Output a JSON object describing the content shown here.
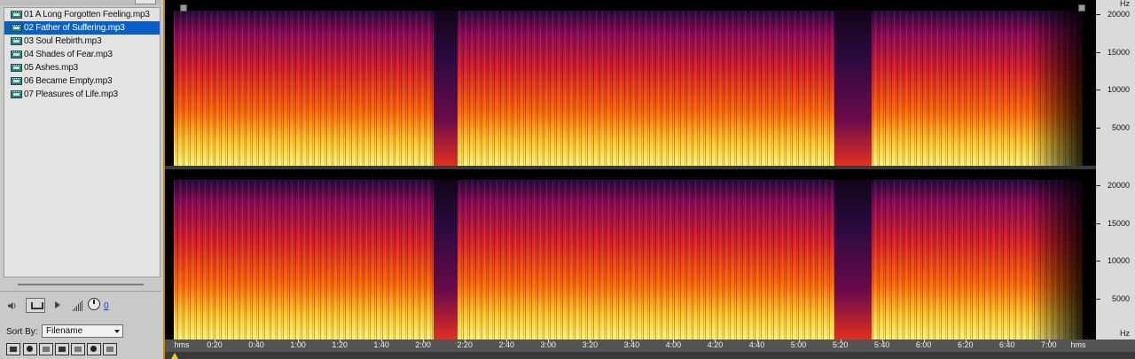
{
  "file_panel": {
    "files": [
      "01 A Long Forgotten Feeling.mp3",
      "02 Father of Suffering.mp3",
      "03 Soul Rebirth.mp3",
      "04 Shades of Fear.mp3",
      "05 Ashes.mp3",
      "06 Became Empty.mp3",
      "07 Pleasures of Life.mp3"
    ],
    "selected_index": 1,
    "volume_value": "0",
    "sort_label": "Sort By:",
    "sort_value": "Filename"
  },
  "spectral_display": {
    "frequency_unit": "Hz",
    "frequency_ticks": [
      "20000",
      "15000",
      "10000",
      "5000"
    ],
    "time_unit": "hms",
    "time_ticks": [
      "0:20",
      "0:40",
      "1:00",
      "1:20",
      "1:40",
      "2:00",
      "2:20",
      "2:40",
      "3:00",
      "3:20",
      "3:40",
      "4:00",
      "4:20",
      "4:40",
      "5:00",
      "5:20",
      "5:40",
      "6:00",
      "6:20",
      "6:40",
      "7:00"
    ],
    "channels": 2,
    "colors": {
      "high": "#fff176",
      "mid": "#ff6a00",
      "low": "#b4004e",
      "floor": "#280a3c",
      "silence": "#000000"
    }
  }
}
